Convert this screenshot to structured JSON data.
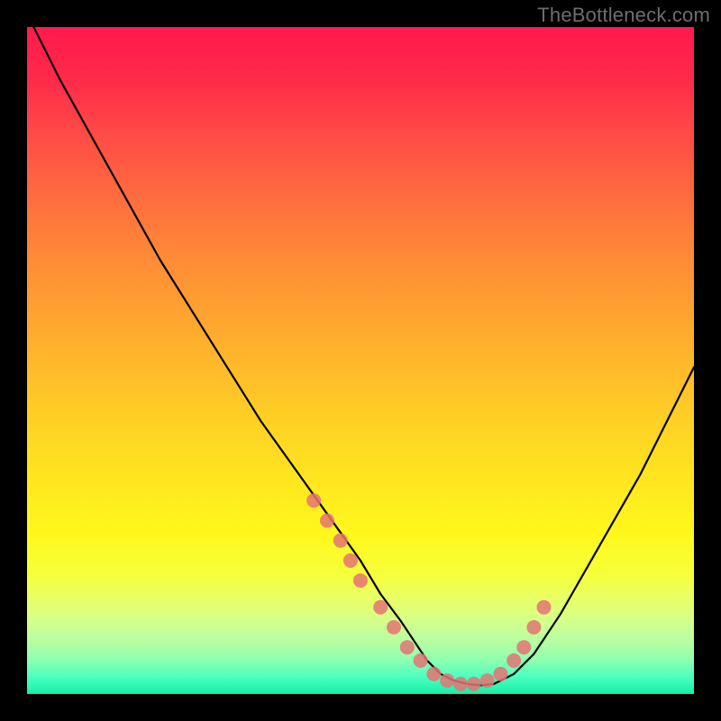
{
  "watermark": "TheBottleneck.com",
  "chart_data": {
    "type": "line",
    "title": "",
    "xlabel": "",
    "ylabel": "",
    "xlim": [
      0,
      100
    ],
    "ylim": [
      0,
      100
    ],
    "series": [
      {
        "name": "bottleneck-curve",
        "x": [
          1,
          5,
          10,
          15,
          20,
          25,
          30,
          35,
          40,
          45,
          50,
          53,
          56,
          58,
          60,
          62,
          64,
          66,
          68,
          70,
          73,
          76,
          80,
          84,
          88,
          92,
          96,
          100
        ],
        "values": [
          100,
          92,
          83,
          74,
          65,
          57,
          49,
          41,
          34,
          27,
          20,
          15,
          11,
          8,
          5,
          3,
          2,
          1.5,
          1.3,
          1.5,
          3,
          6,
          12,
          19,
          26,
          33,
          41,
          49
        ]
      }
    ],
    "markers": {
      "name": "highlight-dots",
      "x": [
        43,
        45,
        47,
        48.5,
        50,
        53,
        55,
        57,
        59,
        61,
        63,
        65,
        67,
        69,
        71,
        73,
        74.5,
        76,
        77.5
      ],
      "values": [
        29,
        26,
        23,
        20,
        17,
        13,
        10,
        7,
        5,
        3,
        2,
        1.5,
        1.5,
        2,
        3,
        5,
        7,
        10,
        13
      ]
    },
    "background_gradient": {
      "top": "#ff1a4d",
      "mid": "#ffe61f",
      "bottom": "#14f0a8"
    }
  }
}
